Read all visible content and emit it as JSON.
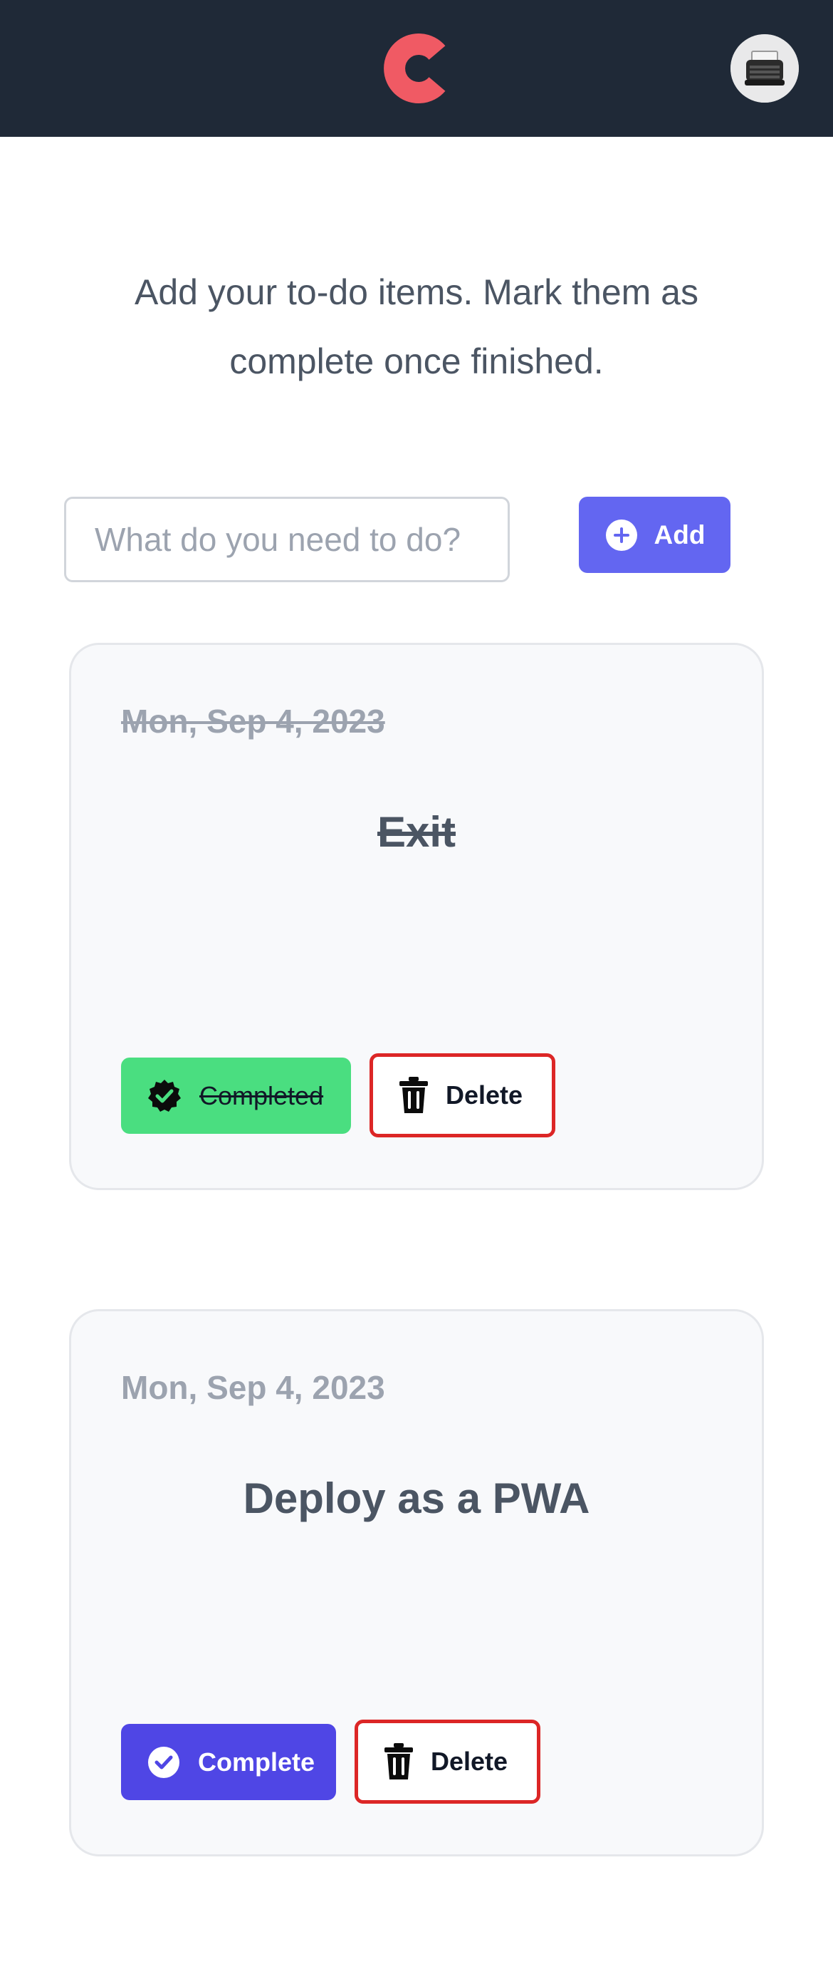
{
  "header": {
    "logo_icon": "c-logo-icon",
    "logo_color": "#f05a64",
    "avatar_icon": "typewriter-avatar-icon"
  },
  "intro": {
    "text": "Add your to-do items. Mark them as complete once finished."
  },
  "new_todo": {
    "placeholder": "What do you need to do?",
    "value": "",
    "add_label": "Add",
    "add_icon": "plus-circle-icon"
  },
  "todos": [
    {
      "date": "Mon, Sep 4, 2023",
      "title": "Exit",
      "completed": true,
      "status_label": "Completed",
      "status_icon": "check-badge-icon",
      "delete_label": "Delete",
      "delete_icon": "trash-icon"
    },
    {
      "date": "Mon, Sep 4, 2023",
      "title": "Deploy as a PWA",
      "completed": false,
      "status_label": "Complete",
      "status_icon": "check-circle-icon",
      "delete_label": "Delete",
      "delete_icon": "trash-icon"
    }
  ],
  "colors": {
    "header_bg": "#1f2937",
    "add_button": "#6366f1",
    "completed_green": "#4ade80",
    "complete_indigo": "#4f46e5",
    "delete_border": "#dc2626"
  }
}
